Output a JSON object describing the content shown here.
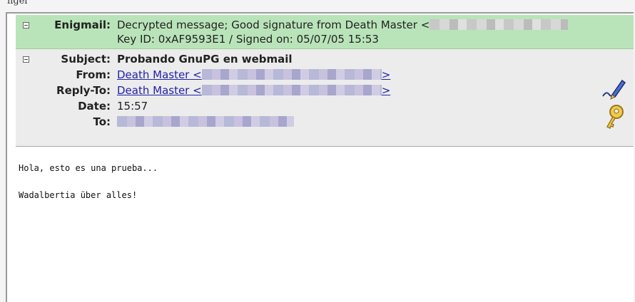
{
  "caption": "ngel",
  "enigmail": {
    "label": "Enigmail:",
    "status_line1": "Decrypted message; Good signature from Death Master <",
    "status_line2": "Key ID: 0xAF9593E1 / Signed on: 05/07/05 15:53"
  },
  "headers": {
    "subject_label": "Subject:",
    "subject_value": "Probando GnuPG en webmail",
    "from_label": "From:",
    "from_name": "Death Master <",
    "from_close": ">",
    "replyto_label": "Reply-To:",
    "replyto_name": "Death Master <",
    "replyto_close": ">",
    "date_label": "Date:",
    "date_value": "15:57",
    "to_label": "To:"
  },
  "icons": [
    "collapse-icon",
    "signed-pen-icon",
    "decrypted-key-icon"
  ],
  "body": {
    "line1": "Hola, esto es una prueba...",
    "line2": "Wadalbertia über alles!"
  },
  "colors": {
    "enigmail_bg": "#b9e4b9",
    "header_bg": "#ececec",
    "link": "#2222aa"
  }
}
